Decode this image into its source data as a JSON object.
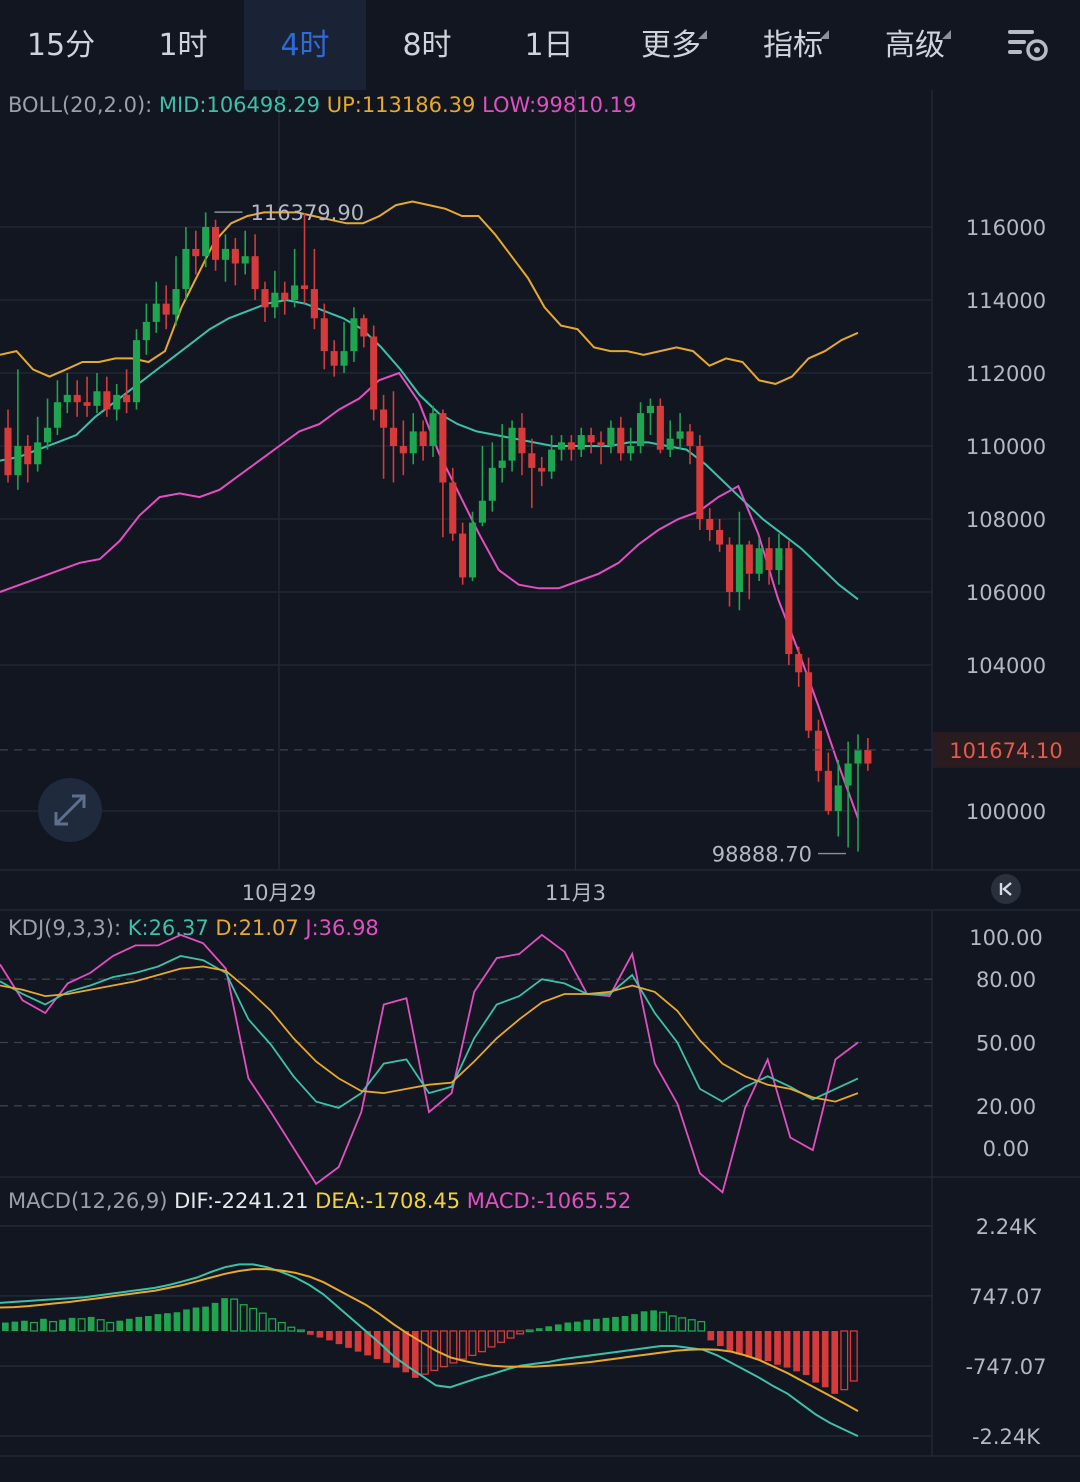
{
  "tabs": [
    {
      "label": "15分",
      "active": false,
      "dropdown": false
    },
    {
      "label": "1时",
      "active": false,
      "dropdown": false
    },
    {
      "label": "4时",
      "active": true,
      "dropdown": false
    },
    {
      "label": "8时",
      "active": false,
      "dropdown": false
    },
    {
      "label": "1日",
      "active": false,
      "dropdown": false
    },
    {
      "label": "更多",
      "active": false,
      "dropdown": true
    },
    {
      "label": "指标",
      "active": false,
      "dropdown": true
    },
    {
      "label": "高级",
      "active": false,
      "dropdown": true
    }
  ],
  "settings_icon": "chart-settings-icon",
  "expand_icon": "expand-icon",
  "jump_latest_icon": "jump-to-latest-icon",
  "colors": {
    "up": "#1fa44f",
    "down": "#d63a3a",
    "mid": "#3cc1a8",
    "upper": "#e6a92d",
    "lower": "#e24fc0",
    "k": "#3cc1a8",
    "d": "#e6a92d",
    "j": "#e24fc0",
    "dif": "#3cc1a8",
    "dea": "#e6a92d",
    "accent": "#2f6bd8",
    "price_tag": "#e05c4c"
  },
  "boll": {
    "name": "BOLL(20,2.0):",
    "mid_label": "MID:106498.29",
    "up_label": "UP:113186.39",
    "low_label": "LOW:99810.19"
  },
  "kdj": {
    "name": "KDJ(9,3,3):",
    "k_label": "K:26.37",
    "d_label": "D:21.07",
    "j_label": "J:36.98"
  },
  "macd": {
    "name": "MACD(12,26,9)",
    "dif_label": "DIF:-2241.21",
    "dea_label": "DEA:-1708.45",
    "macd_label": "MACD:-1065.52"
  },
  "chart_data": [
    {
      "type": "candlestick",
      "indicator": "BOLL",
      "y_ticks": [
        "116000",
        "114000",
        "112000",
        "110000",
        "108000",
        "106000",
        "104000",
        "100000"
      ],
      "y_tick_values": [
        116000,
        114000,
        112000,
        110000,
        108000,
        106000,
        104000,
        100000
      ],
      "ylim": [
        98000,
        120000
      ],
      "x_labels": [
        "10月29",
        "11月3"
      ],
      "x_label_index": [
        26,
        56
      ],
      "last_price": "101674.10",
      "last_price_value": 101674.1,
      "high_mark": "116379.90",
      "low_mark": "98888.70",
      "candles": [
        [
          110500,
          109200,
          111000,
          109000
        ],
        [
          109200,
          110000,
          112100,
          108800
        ],
        [
          110000,
          109500,
          110300,
          109000
        ],
        [
          109500,
          110100,
          110800,
          109300
        ],
        [
          110100,
          110500,
          111300,
          109900
        ],
        [
          110500,
          111200,
          111800,
          110300
        ],
        [
          111200,
          111400,
          112000,
          110900
        ],
        [
          111400,
          111200,
          111800,
          110800
        ],
        [
          111200,
          111100,
          111900,
          110800
        ],
        [
          111100,
          111500,
          112000,
          110900
        ],
        [
          111500,
          111000,
          111900,
          110800
        ],
        [
          111000,
          111400,
          111700,
          110700
        ],
        [
          111400,
          111200,
          112100,
          110900
        ],
        [
          111200,
          112900,
          113200,
          111000
        ],
        [
          112900,
          113400,
          113900,
          112500
        ],
        [
          113400,
          113900,
          114500,
          113100
        ],
        [
          113900,
          113600,
          114400,
          113200
        ],
        [
          113600,
          114300,
          115200,
          113300
        ],
        [
          114300,
          115400,
          116000,
          114000
        ],
        [
          115400,
          115200,
          115900,
          114700
        ],
        [
          115200,
          116000,
          116400,
          114900
        ],
        [
          116000,
          115100,
          116200,
          114800
        ],
        [
          115100,
          115400,
          115800,
          114500
        ],
        [
          115400,
          115000,
          115700,
          114400
        ],
        [
          115000,
          115200,
          115900,
          114700
        ],
        [
          115200,
          114300,
          115800,
          114000
        ],
        [
          114300,
          113800,
          114500,
          113400
        ],
        [
          113800,
          114200,
          114800,
          113500
        ],
        [
          114200,
          114000,
          114500,
          113600
        ],
        [
          114000,
          114400,
          115400,
          113800
        ],
        [
          114400,
          114300,
          116379.9,
          113900
        ],
        [
          114300,
          113500,
          115400,
          113200
        ],
        [
          113500,
          112600,
          113900,
          112100
        ],
        [
          112600,
          112200,
          112900,
          111900
        ],
        [
          112200,
          112600,
          113400,
          112000
        ],
        [
          112600,
          113500,
          113800,
          112300
        ],
        [
          113500,
          113000,
          113600,
          112700
        ],
        [
          113000,
          111000,
          113300,
          110700
        ],
        [
          111000,
          110500,
          111400,
          109100
        ],
        [
          110500,
          110000,
          111500,
          109000
        ],
        [
          110000,
          109800,
          110700,
          109200
        ],
        [
          109800,
          110400,
          110900,
          109500
        ],
        [
          110400,
          110000,
          110700,
          109600
        ],
        [
          110000,
          110900,
          111100,
          109700
        ],
        [
          110900,
          109000,
          111000,
          107500
        ],
        [
          109000,
          107600,
          109400,
          107400
        ],
        [
          107600,
          106400,
          107900,
          106200
        ],
        [
          106400,
          107900,
          108200,
          106300
        ],
        [
          107900,
          108500,
          110000,
          107800
        ],
        [
          108500,
          109400,
          110100,
          108200
        ],
        [
          109400,
          109600,
          110600,
          109000
        ],
        [
          109600,
          110500,
          110700,
          109300
        ],
        [
          110500,
          109800,
          110900,
          109200
        ],
        [
          109800,
          109400,
          110200,
          108300
        ],
        [
          109400,
          109300,
          109700,
          108900
        ],
        [
          109300,
          109900,
          110300,
          109100
        ],
        [
          109900,
          110100,
          110300,
          109600
        ],
        [
          110100,
          109900,
          110300,
          109600
        ],
        [
          109900,
          110300,
          110500,
          109700
        ],
        [
          110300,
          110100,
          110500,
          109800
        ],
        [
          110100,
          110000,
          110400,
          109500
        ],
        [
          110000,
          110500,
          110700,
          109800
        ],
        [
          110500,
          109800,
          110800,
          109600
        ],
        [
          109800,
          110000,
          110500,
          109600
        ],
        [
          110000,
          110900,
          111200,
          109800
        ],
        [
          110900,
          111100,
          111300,
          110300
        ],
        [
          111100,
          109900,
          111300,
          109800
        ],
        [
          109900,
          110200,
          110700,
          109700
        ],
        [
          110200,
          110400,
          110900,
          109900
        ],
        [
          110400,
          110000,
          110600,
          109500
        ],
        [
          110000,
          108000,
          110300,
          107700
        ],
        [
          108000,
          107700,
          108300,
          107400
        ],
        [
          107700,
          107300,
          108000,
          107100
        ],
        [
          107300,
          106000,
          107500,
          105600
        ],
        [
          106000,
          107300,
          108200,
          105500
        ],
        [
          107300,
          106500,
          107400,
          105800
        ],
        [
          106500,
          107200,
          107500,
          106300
        ],
        [
          107200,
          106600,
          107500,
          106200
        ],
        [
          106600,
          107200,
          107600,
          106200
        ],
        [
          107200,
          104300,
          107400,
          104000
        ],
        [
          104300,
          103800,
          104500,
          103400
        ],
        [
          103800,
          102200,
          104200,
          102000
        ],
        [
          102200,
          101100,
          102500,
          100800
        ],
        [
          101100,
          100000,
          101600,
          99900
        ],
        [
          100000,
          100700,
          101400,
          99300
        ],
        [
          100700,
          101300,
          101900,
          99000
        ],
        [
          101300,
          101674.1,
          102100,
          98888.7
        ],
        [
          101674.1,
          101300,
          102000,
          101100
        ]
      ],
      "upper": [
        112500,
        112600,
        112100,
        111900,
        112100,
        112300,
        112300,
        112400,
        112400,
        112300,
        112600,
        113800,
        114700,
        115600,
        116100,
        116300,
        116400,
        116400,
        116400,
        116300,
        116200,
        116100,
        116100,
        116300,
        116600,
        116700,
        116600,
        116500,
        116300,
        116300,
        115800,
        115200,
        114600,
        113800,
        113300,
        113200,
        112700,
        112600,
        112600,
        112500,
        112600,
        112700,
        112600,
        112200,
        112400,
        112300,
        111800,
        111700,
        111900,
        112400,
        112600,
        112900,
        113100
      ],
      "mid": [
        109600,
        109700,
        109900,
        110100,
        110300,
        110800,
        111200,
        111600,
        112000,
        112400,
        112800,
        113200,
        113500,
        113700,
        113900,
        114000,
        113900,
        113700,
        113500,
        113200,
        112700,
        112100,
        111400,
        110900,
        110600,
        110400,
        110300,
        110200,
        110100,
        110000,
        110000,
        110000,
        110000,
        110100,
        110100,
        110000,
        109900,
        109500,
        109000,
        108500,
        108000,
        107600,
        107200,
        106700,
        106200,
        105800
      ],
      "lower": [
        106000,
        106200,
        106400,
        106600,
        106800,
        106900,
        107400,
        108100,
        108600,
        108700,
        108600,
        108800,
        109200,
        109600,
        110000,
        110400,
        110600,
        111000,
        111300,
        111800,
        112000,
        111200,
        109800,
        108700,
        107600,
        106600,
        106200,
        106100,
        106100,
        106300,
        106500,
        106800,
        107300,
        107700,
        108000,
        108200,
        108600,
        108900,
        107600,
        105800,
        104400,
        102900,
        101300,
        99800
      ]
    },
    {
      "type": "line",
      "indicator": "KDJ",
      "y_ticks": [
        "100.00",
        "80.00",
        "50.00",
        "20.00",
        "0.00"
      ],
      "y_tick_values": [
        100,
        80,
        50,
        20,
        0
      ],
      "ylim": [
        -5,
        105
      ],
      "K": [
        79,
        73,
        68,
        74,
        77,
        81,
        83,
        86,
        91,
        89,
        83,
        61,
        49,
        34,
        22,
        19,
        26,
        40,
        42,
        26,
        29,
        52,
        68,
        72,
        80,
        78,
        73,
        73,
        82,
        64,
        50,
        28,
        22,
        29,
        34,
        29,
        23,
        28,
        33
      ],
      "D": [
        77,
        75,
        72,
        73,
        75,
        77,
        79,
        82,
        85,
        86,
        84,
        75,
        65,
        52,
        41,
        33,
        27,
        26,
        28,
        30,
        31,
        41,
        52,
        61,
        69,
        73,
        73,
        74,
        77,
        74,
        65,
        51,
        40,
        34,
        30,
        28,
        24,
        22,
        26
      ],
      "J": [
        87,
        70,
        64,
        78,
        83,
        91,
        96,
        96,
        101,
        97,
        85,
        33,
        17,
        0,
        -17,
        -9,
        17,
        68,
        71,
        17,
        26,
        74,
        90,
        92,
        101,
        93,
        73,
        72,
        92,
        40,
        21,
        -12,
        -21,
        19,
        42,
        5,
        -1,
        42,
        50
      ]
    },
    {
      "type": "bar+line",
      "indicator": "MACD",
      "y_ticks": [
        "2.24K",
        "747.07",
        "-747.07",
        "-2.24K"
      ],
      "y_tick_values": [
        2240,
        747.07,
        -747.07,
        -2240
      ],
      "ylim": [
        -2600,
        2600
      ],
      "hist": [
        180,
        200,
        220,
        180,
        260,
        200,
        240,
        280,
        260,
        300,
        240,
        180,
        220,
        260,
        300,
        320,
        360,
        380,
        400,
        460,
        500,
        520,
        600,
        700,
        680,
        560,
        480,
        380,
        260,
        180,
        80,
        20,
        -80,
        -140,
        -200,
        -280,
        -360,
        -440,
        -520,
        -600,
        -680,
        -780,
        -880,
        -1000,
        -920,
        -840,
        -760,
        -680,
        -600,
        -520,
        -440,
        -340,
        -240,
        -150,
        -60,
        20,
        60,
        100,
        140,
        180,
        200,
        240,
        260,
        280,
        300,
        320,
        360,
        420,
        440,
        400,
        320,
        280,
        240,
        200,
        -200,
        -320,
        -420,
        -500,
        -560,
        -620,
        -640,
        -720,
        -780,
        -860,
        -940,
        -1100,
        -1200,
        -1340,
        -1250,
        -1065.52
      ],
      "dif": [
        600,
        620,
        640,
        660,
        680,
        700,
        720,
        760,
        800,
        840,
        880,
        920,
        980,
        1060,
        1140,
        1260,
        1360,
        1420,
        1420,
        1360,
        1260,
        1140,
        980,
        780,
        520,
        260,
        0,
        -260,
        -540,
        -760,
        -960,
        -1160,
        -1200,
        -1100,
        -1000,
        -920,
        -820,
        -740,
        -700,
        -660,
        -600,
        -560,
        -520,
        -480,
        -440,
        -400,
        -360,
        -320,
        -320,
        -360,
        -400,
        -520,
        -680,
        -840,
        -1000,
        -1180,
        -1340,
        -1560,
        -1780,
        -1960,
        -2100,
        -2241.21
      ],
      "dea": [
        500,
        510,
        530,
        560,
        590,
        620,
        660,
        700,
        740,
        780,
        820,
        860,
        920,
        980,
        1060,
        1140,
        1220,
        1280,
        1320,
        1320,
        1290,
        1240,
        1160,
        1040,
        880,
        720,
        560,
        360,
        140,
        -60,
        -240,
        -420,
        -560,
        -640,
        -700,
        -740,
        -760,
        -760,
        -760,
        -740,
        -720,
        -690,
        -660,
        -620,
        -580,
        -540,
        -500,
        -460,
        -420,
        -400,
        -390,
        -400,
        -440,
        -520,
        -620,
        -760,
        -900,
        -1060,
        -1220,
        -1380,
        -1540,
        -1708.45
      ]
    }
  ]
}
